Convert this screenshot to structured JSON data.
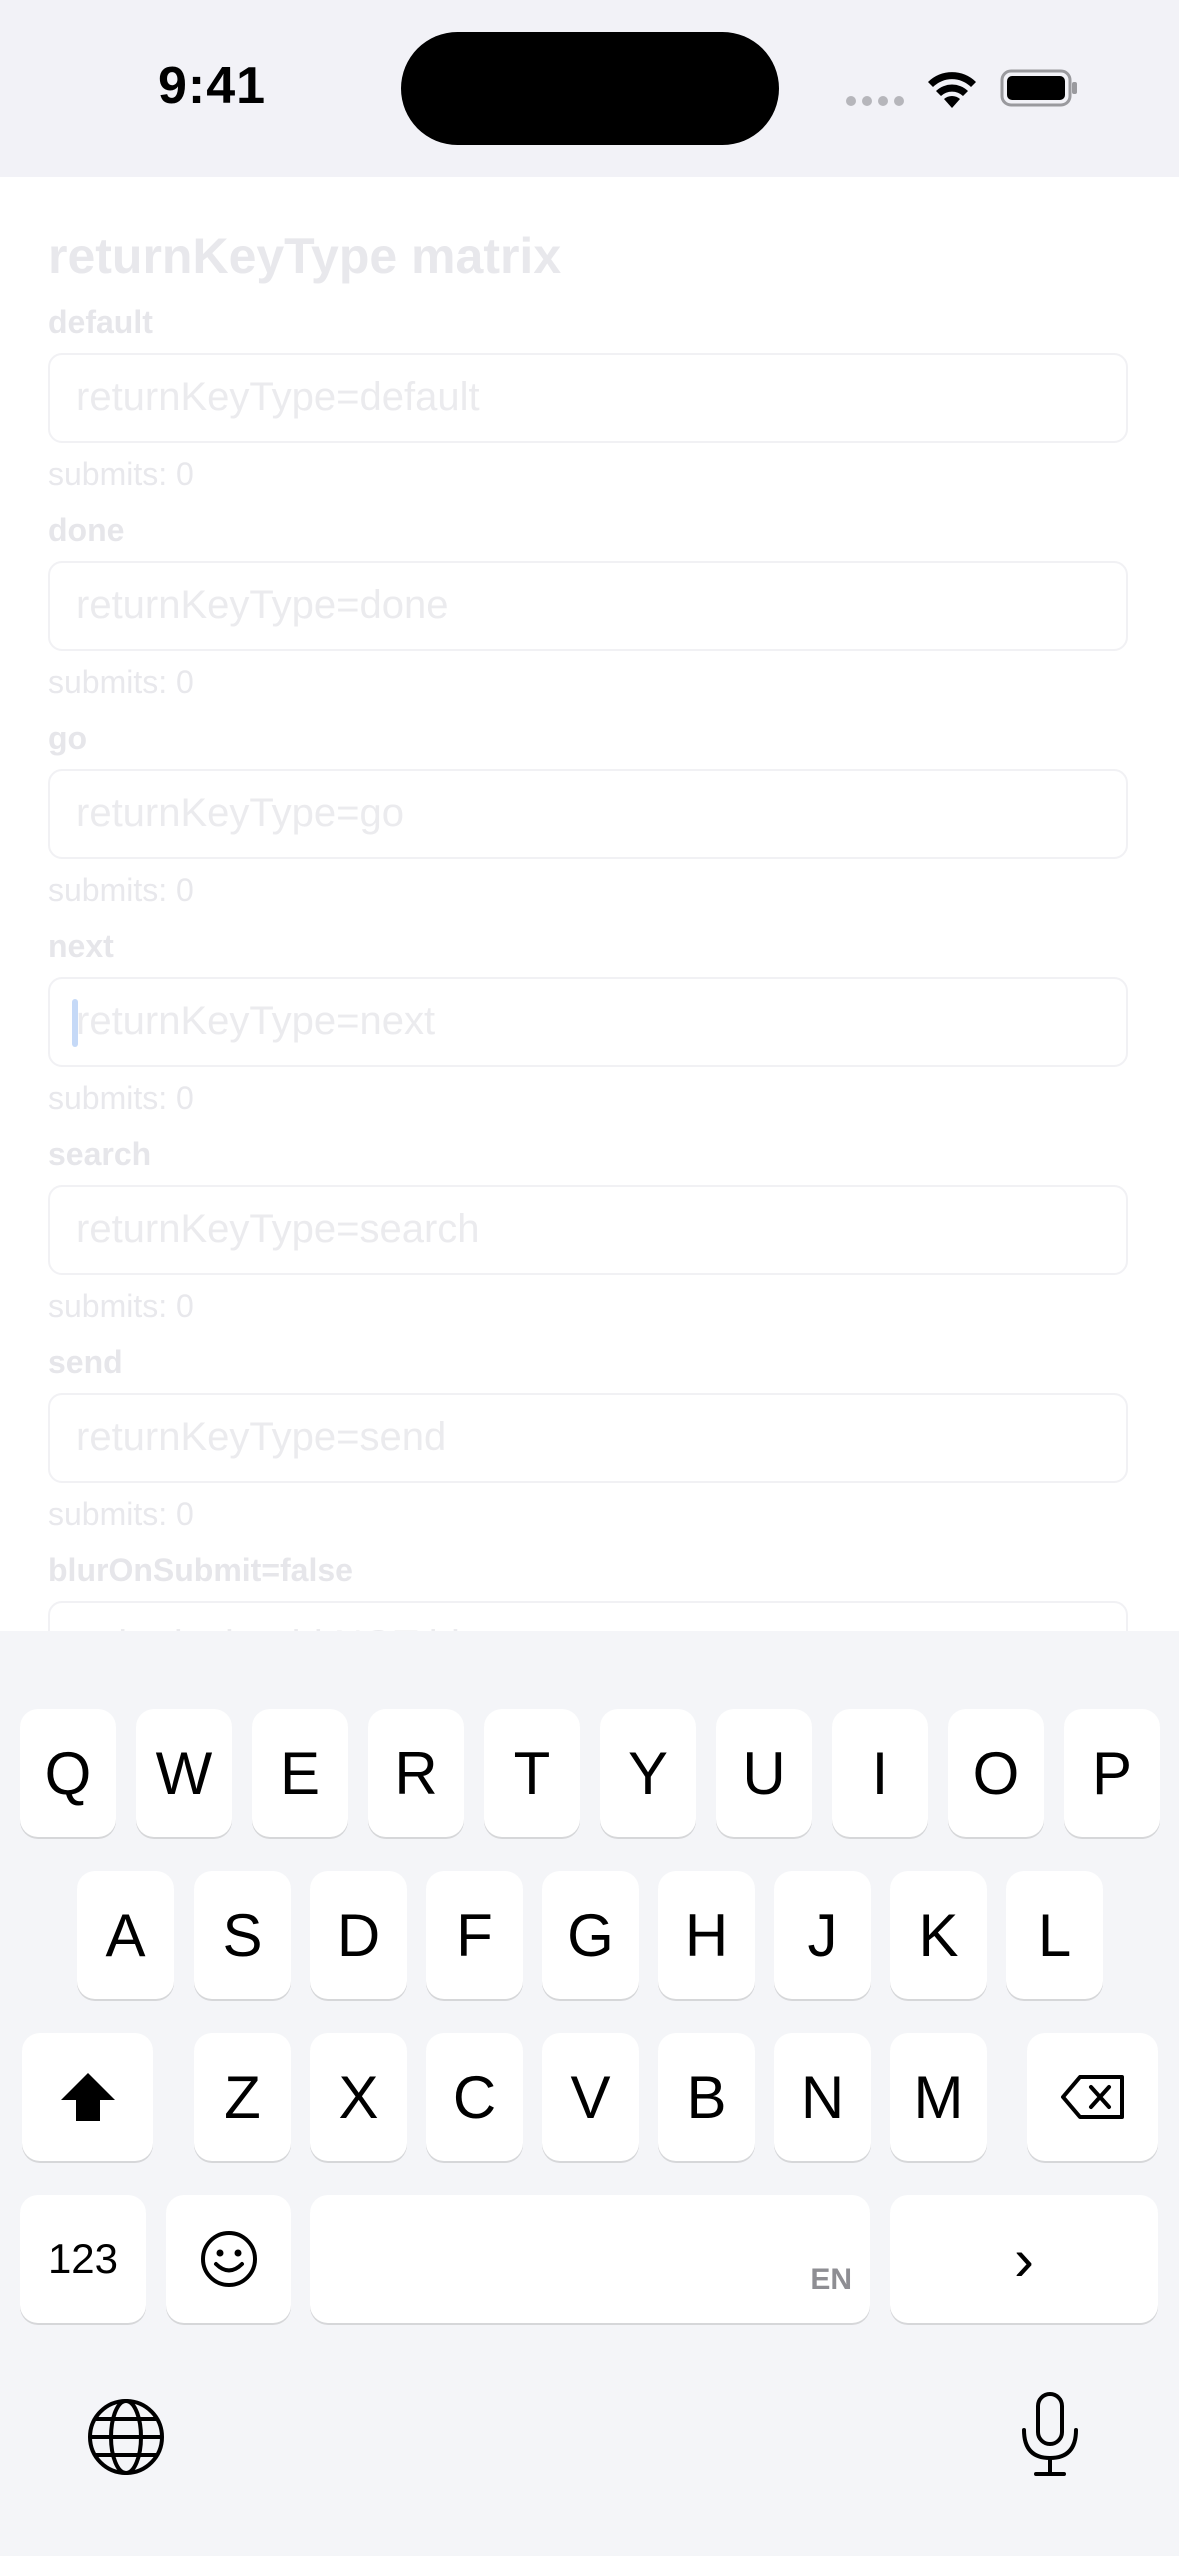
{
  "status_bar": {
    "time": "9:41"
  },
  "screen": {
    "title": "returnKeyType matrix",
    "rows": [
      {
        "label": "default",
        "placeholder": "returnKeyType=default",
        "submits": "submits: 0"
      },
      {
        "label": "done",
        "placeholder": "returnKeyType=done",
        "submits": "submits: 0"
      },
      {
        "label": "go",
        "placeholder": "returnKeyType=go",
        "submits": "submits: 0"
      },
      {
        "label": "next",
        "placeholder": "returnKeyType=next",
        "submits": "submits: 0"
      },
      {
        "label": "search",
        "placeholder": "returnKeyType=search",
        "submits": "submits: 0"
      },
      {
        "label": "send",
        "placeholder": "returnKeyType=send",
        "submits": "submits: 0"
      },
      {
        "label": "blurOnSubmit=false",
        "placeholder": "submit should NOT blur"
      }
    ]
  },
  "keyboard": {
    "row1": [
      "Q",
      "W",
      "E",
      "R",
      "T",
      "Y",
      "U",
      "I",
      "O",
      "P"
    ],
    "row2": [
      "A",
      "S",
      "D",
      "F",
      "G",
      "H",
      "J",
      "K",
      "L"
    ],
    "row3": [
      "Z",
      "X",
      "C",
      "V",
      "B",
      "N",
      "M"
    ],
    "numbers_label": "123",
    "space_language": "EN",
    "return_key_symbol": "›",
    "icons": {
      "shift": "shift-icon",
      "delete": "delete-icon",
      "emoji": "emoji-icon",
      "globe": "globe-icon",
      "microphone": "microphone-icon"
    }
  }
}
